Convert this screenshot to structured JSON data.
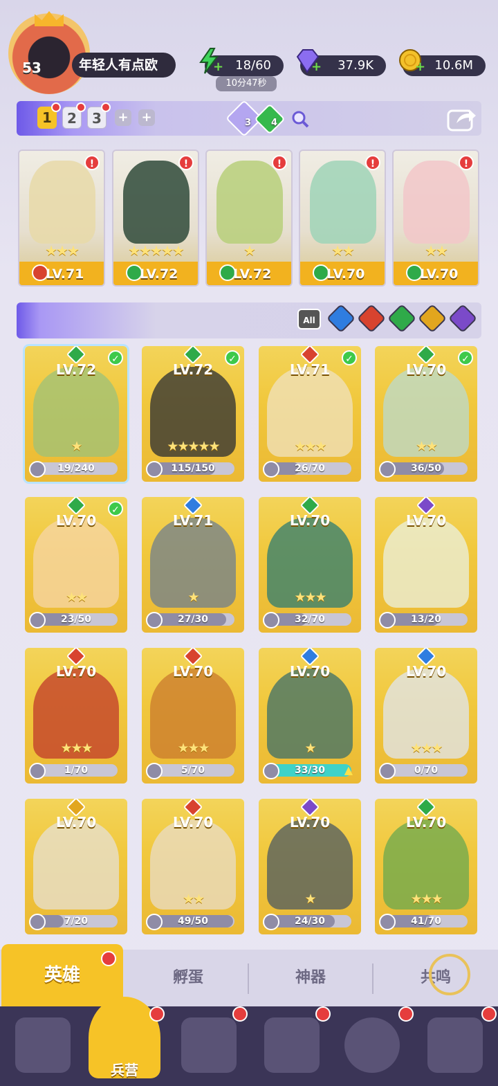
{
  "player": {
    "level": "53",
    "name": "年轻人有点欧"
  },
  "resources": {
    "energy": "18/60",
    "energy_timer": "10分47秒",
    "gems": "37.9K",
    "gold": "10.6M"
  },
  "teams": {
    "slots": [
      "1",
      "2",
      "3"
    ],
    "active": "1",
    "add_icon": "+",
    "gem_purple_count": "3",
    "gem_green_count": "4"
  },
  "team_cards": [
    {
      "level": "LV.71",
      "stars": "★★★",
      "element": "fire"
    },
    {
      "level": "LV.72",
      "stars": "★★★★★",
      "element": "earth"
    },
    {
      "level": "LV.72",
      "stars": "★",
      "element": "earth"
    },
    {
      "level": "LV.70",
      "stars": "★★",
      "element": "earth"
    },
    {
      "level": "LV.70",
      "stars": "★★",
      "element": "earth"
    }
  ],
  "filter": {
    "all_label": "All",
    "elements": [
      "water",
      "fire",
      "earth",
      "light",
      "dark"
    ]
  },
  "heroes": [
    {
      "level": "LV.72",
      "progress": "19/240",
      "stars": "★",
      "element": "earth",
      "checked": true
    },
    {
      "level": "LV.72",
      "progress": "115/150",
      "stars": "★★★★★",
      "element": "earth",
      "checked": true
    },
    {
      "level": "LV.71",
      "progress": "26/70",
      "stars": "★★★",
      "element": "fire",
      "checked": true
    },
    {
      "level": "LV.70",
      "progress": "36/50",
      "stars": "★★",
      "element": "earth",
      "checked": true
    },
    {
      "level": "LV.70",
      "progress": "23/50",
      "stars": "★★",
      "element": "earth",
      "checked": true
    },
    {
      "level": "LV.71",
      "progress": "27/30",
      "stars": "★",
      "element": "water",
      "checked": false
    },
    {
      "level": "LV.70",
      "progress": "32/70",
      "stars": "★★★",
      "element": "earth",
      "checked": false
    },
    {
      "level": "LV.70",
      "progress": "13/20",
      "stars": "",
      "element": "dark",
      "checked": false
    },
    {
      "level": "LV.70",
      "progress": "1/70",
      "stars": "★★★",
      "element": "fire",
      "checked": false
    },
    {
      "level": "LV.70",
      "progress": "5/70",
      "stars": "★★★",
      "element": "fire",
      "checked": false
    },
    {
      "level": "LV.70",
      "progress": "33/30",
      "stars": "★",
      "element": "water",
      "checked": false
    },
    {
      "level": "LV.70",
      "progress": "0/70",
      "stars": "★★★",
      "element": "water",
      "checked": false
    },
    {
      "level": "LV.70",
      "progress": "7/20",
      "stars": "",
      "element": "light",
      "checked": false
    },
    {
      "level": "LV.70",
      "progress": "49/50",
      "stars": "★★",
      "element": "fire",
      "checked": false
    },
    {
      "level": "LV.70",
      "progress": "24/30",
      "stars": "★",
      "element": "dark",
      "checked": false
    },
    {
      "level": "LV.70",
      "progress": "41/70",
      "stars": "★★★",
      "element": "earth",
      "checked": false
    }
  ],
  "sub_tabs": [
    "英雄",
    "孵蛋",
    "神器",
    "共鸣"
  ],
  "nav": {
    "active_label": "兵营"
  },
  "colors": {
    "fire": "#d8432f",
    "earth": "#2faa49",
    "water": "#2f7de0",
    "light": "#e2a61e",
    "dark": "#7b4ac9",
    "accent": "#f6c327",
    "nav_bg": "#3b3557"
  }
}
